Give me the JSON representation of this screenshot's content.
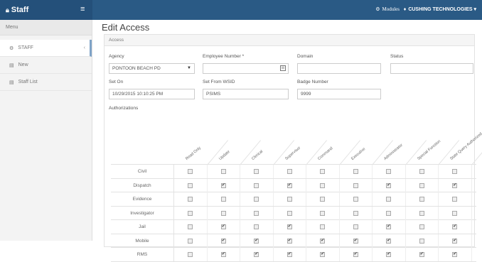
{
  "header": {
    "brand": "Staff",
    "modules": "Modules",
    "company": "CUSHING TECHNOLOGIES ▾"
  },
  "sidebar": {
    "menu_label": "Menu",
    "items": [
      {
        "label": "STAFF",
        "icon": "staff-icon"
      },
      {
        "label": "New",
        "icon": "new-icon"
      },
      {
        "label": "Staff List",
        "icon": "list-icon"
      }
    ]
  },
  "page": {
    "title": "Edit Access",
    "panel_title": "Access"
  },
  "form": {
    "agency_label": "Agency",
    "agency_value": "PONTOON BEACH PD",
    "employee_label": "Employee Number *",
    "employee_value": "",
    "domain_label": "Domain",
    "domain_value": "",
    "status_label": "Status",
    "status_value": "",
    "set_on_label": "Set On",
    "set_on_value": "10/29/2015 10:10:25 PM",
    "set_from_label": "Set From WSID",
    "set_from_value": "PSIMS",
    "badge_label": "Badge Number",
    "badge_value": "9999"
  },
  "authorizations": {
    "title": "Authorizations",
    "columns": [
      "Read Only",
      "Update",
      "Clerical",
      "Supervisor",
      "Command",
      "Executive",
      "Administrator",
      "Special Function",
      "State Query Authorized"
    ],
    "rows": [
      {
        "label": "Civil",
        "checks": [
          false,
          false,
          false,
          false,
          false,
          false,
          false,
          false,
          false
        ]
      },
      {
        "label": "Dispatch",
        "checks": [
          false,
          true,
          false,
          true,
          false,
          false,
          true,
          false,
          true
        ]
      },
      {
        "label": "Evidence",
        "checks": [
          false,
          false,
          false,
          false,
          false,
          false,
          false,
          false,
          false
        ]
      },
      {
        "label": "Investigator",
        "checks": [
          false,
          false,
          false,
          false,
          false,
          false,
          false,
          false,
          false
        ]
      },
      {
        "label": "Jail",
        "checks": [
          false,
          true,
          false,
          true,
          false,
          false,
          true,
          false,
          true
        ]
      },
      {
        "label": "Mobile",
        "checks": [
          false,
          true,
          true,
          true,
          true,
          true,
          true,
          false,
          true
        ]
      },
      {
        "label": "RMS",
        "checks": [
          false,
          true,
          true,
          true,
          true,
          true,
          true,
          true,
          true
        ]
      }
    ]
  }
}
